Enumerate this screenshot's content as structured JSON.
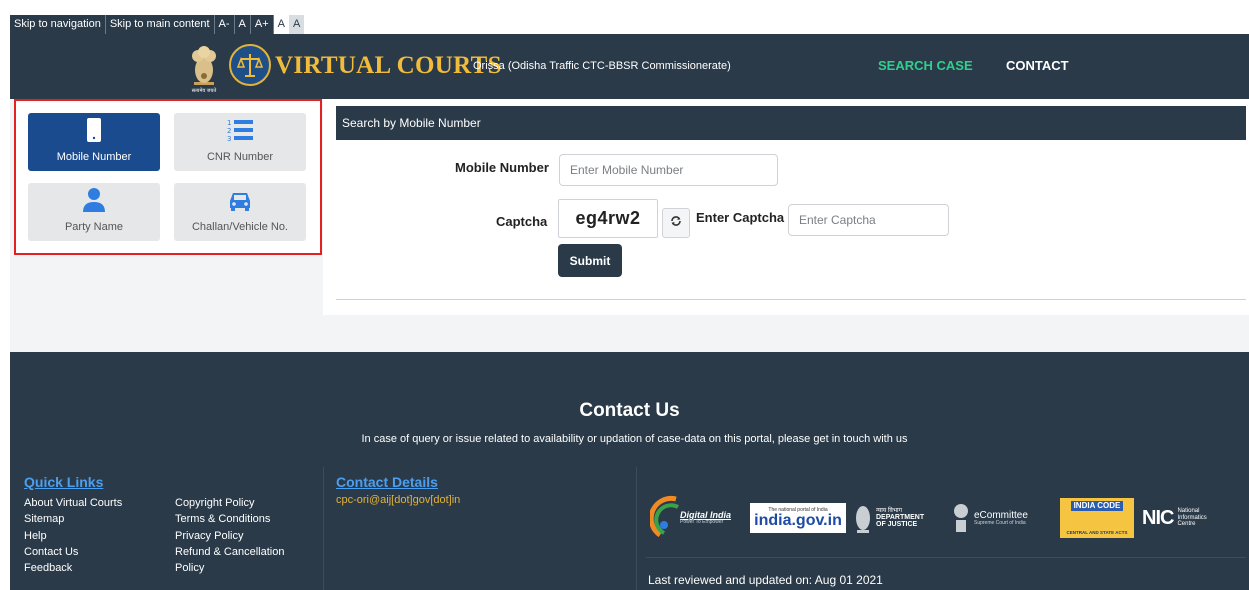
{
  "accessibility": {
    "skip_nav": "Skip to navigation",
    "skip_main": "Skip to main content",
    "font_decrease": "A-",
    "font_normal": "A",
    "font_increase": "A+",
    "contrast_light": "A",
    "contrast_dark": "A"
  },
  "header": {
    "brand": "VIRTUAL COURTS",
    "court_name": "Orissa (Odisha Traffic CTC-BBSR Commissionerate)",
    "nav": {
      "search_case": "SEARCH CASE",
      "contact": "CONTACT"
    },
    "emblem_caption": "सत्यमेव जयते"
  },
  "search_options": {
    "mobile": "Mobile Number",
    "cnr": "CNR Number",
    "party": "Party Name",
    "challan": "Challan/Vehicle No."
  },
  "form": {
    "title": "Search by Mobile Number",
    "mobile_label": "Mobile Number",
    "mobile_placeholder": "Enter Mobile Number",
    "captcha_label": "Captcha",
    "captcha_value": "eg4rw2",
    "enter_captcha_label": "Enter Captcha",
    "captcha_placeholder": "Enter Captcha",
    "submit": "Submit"
  },
  "footer": {
    "contact_title": "Contact Us",
    "contact_subtitle": "In case of query or issue related to availability or updation of case-data on this portal, please get in touch with us",
    "quick_links_title": "Quick Links",
    "quick_links_col1": [
      "About Virtual Courts",
      "Sitemap",
      "Help",
      "Contact Us",
      "Feedback"
    ],
    "quick_links_col2": [
      "Copyright Policy",
      "Terms & Conditions",
      "Privacy Policy",
      "Refund & Cancellation",
      "Policy"
    ],
    "contact_details_title": "Contact Details",
    "contact_email": "cpc-ori@aij[dot]gov[dot]in",
    "reviewed": "Last reviewed and updated on: Aug 01 2021",
    "logos": {
      "digital_india": "Digital India",
      "digital_india_tag": "Power To Empower",
      "india_gov": "india.gov.in",
      "india_gov_tag": "The national portal of India",
      "doj_hindi": "न्याय विभाग",
      "doj": "DEPARTMENT OF JUSTICE",
      "ecommittee": "eCommittee",
      "ecommittee_tag": "Supreme Court of India",
      "india_code": "INDIA CODE",
      "india_code_tag": "CENTRAL AND STATE ACTS",
      "nic": "NIC",
      "nic_full": "National Informatics Centre"
    }
  }
}
